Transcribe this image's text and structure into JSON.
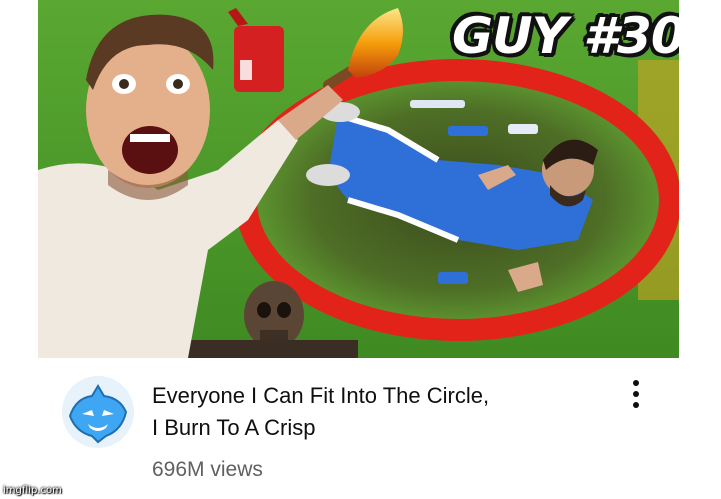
{
  "thumbnail": {
    "overlay_text": "GUY #30",
    "icon": "video-thumbnail-challenge-circle",
    "colors": {
      "grass": "#4f9a2c",
      "circle": "#e2231a",
      "suit": "#2f6fd8"
    }
  },
  "channel": {
    "avatar_icon": "wolf-mascot-icon",
    "avatar_color": "#3ea6f2"
  },
  "video": {
    "title_line_1": "Everyone I Can Fit Into The Circle,",
    "title_line_2": "I Burn To A Crisp",
    "views": "696M views"
  },
  "actions": {
    "more_icon": "vertical-ellipsis-icon"
  },
  "watermark": {
    "text": "imgflip.com"
  }
}
